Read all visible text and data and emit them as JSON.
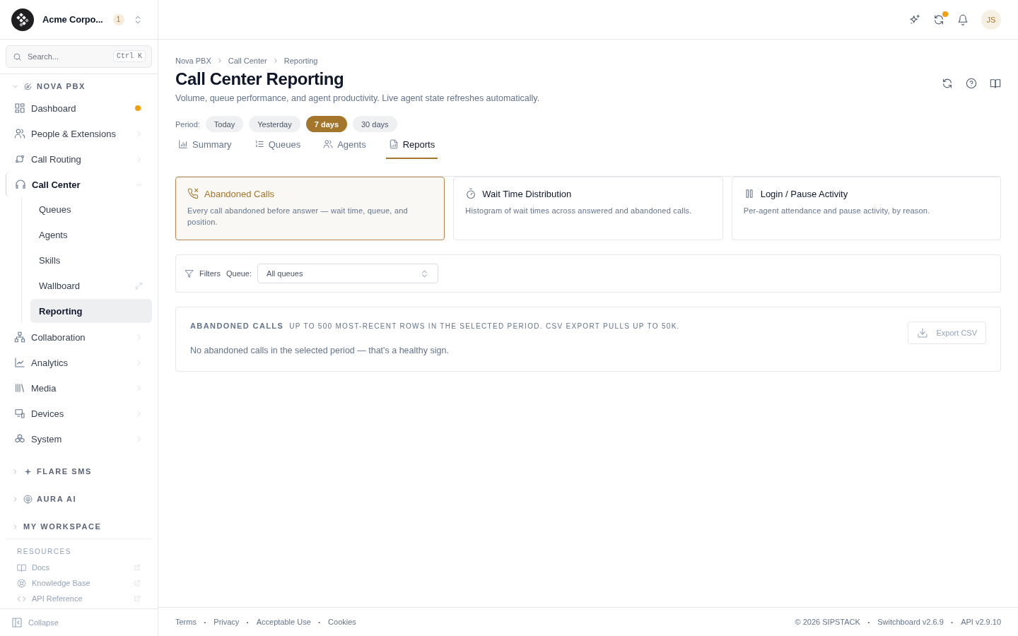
{
  "org": {
    "name": "Acme Corpo...",
    "badge": "1"
  },
  "search": {
    "placeholder": "Search...",
    "shortcut": "Ctrl K"
  },
  "nav_sections": [
    {
      "label": "NOVA PBX",
      "expanded": true,
      "items": [
        {
          "label": "Dashboard",
          "kind": "link",
          "alert": true,
          "selected": false
        },
        {
          "label": "People & Extensions",
          "kind": "group",
          "expanded": false,
          "selected": false
        },
        {
          "label": "Call Routing",
          "kind": "group",
          "expanded": false,
          "selected": false
        },
        {
          "label": "Call Center",
          "kind": "group",
          "expanded": true,
          "selected": true,
          "children": [
            {
              "label": "Queues",
              "selected": false,
              "external": false
            },
            {
              "label": "Agents",
              "selected": false,
              "external": false
            },
            {
              "label": "Skills",
              "selected": false,
              "external": false
            },
            {
              "label": "Wallboard",
              "selected": false,
              "external": true
            },
            {
              "label": "Reporting",
              "selected": true,
              "external": false
            }
          ]
        },
        {
          "label": "Collaboration",
          "kind": "group",
          "expanded": false,
          "selected": false
        },
        {
          "label": "Analytics",
          "kind": "group",
          "expanded": false,
          "selected": false
        },
        {
          "label": "Media",
          "kind": "group",
          "expanded": false,
          "selected": false
        },
        {
          "label": "Devices",
          "kind": "group",
          "expanded": false,
          "selected": false
        },
        {
          "label": "System",
          "kind": "group",
          "expanded": false,
          "selected": false
        }
      ]
    },
    {
      "label": "FLARE SMS",
      "expanded": false
    },
    {
      "label": "AURA AI",
      "expanded": false
    },
    {
      "label": "MY WORKSPACE",
      "expanded": false
    }
  ],
  "resources": {
    "title": "RESOURCES",
    "items": [
      {
        "label": "Docs"
      },
      {
        "label": "Knowledge Base"
      },
      {
        "label": "API Reference"
      }
    ]
  },
  "collapse": "Collapse",
  "topbar": {
    "avatar": "JS",
    "sync_alert": true
  },
  "breadcrumb": [
    "Nova PBX",
    "Call Center",
    "Reporting"
  ],
  "title": "Call Center Reporting",
  "subtitle": "Volume, queue performance, and agent productivity. Live agent state refreshes automatically.",
  "period": {
    "label": "Period:",
    "options": [
      {
        "label": "Today",
        "selected": false
      },
      {
        "label": "Yesterday",
        "selected": false
      },
      {
        "label": "7 days",
        "selected": true
      },
      {
        "label": "30 days",
        "selected": false
      }
    ]
  },
  "tabs": [
    {
      "label": "Summary",
      "selected": false
    },
    {
      "label": "Queues",
      "selected": false
    },
    {
      "label": "Agents",
      "selected": false
    },
    {
      "label": "Reports",
      "selected": true
    }
  ],
  "report_cards": [
    {
      "title": "Abandoned Calls",
      "description": "Every call abandoned before answer — wait time, queue, and position.",
      "selected": true
    },
    {
      "title": "Wait Time Distribution",
      "description": "Histogram of wait times across answered and abandoned calls.",
      "selected": false
    },
    {
      "title": "Login / Pause Activity",
      "description": "Per-agent attendance and pause activity, by reason.",
      "selected": false
    }
  ],
  "filters": {
    "label": "Filters",
    "queue_label": "Queue:",
    "queue_value": "All queues"
  },
  "results": {
    "title": "ABANDONED CALLS",
    "note": "UP TO 500 MOST-RECENT ROWS IN THE SELECTED PERIOD. CSV EXPORT PULLS UP TO 50K.",
    "export": "Export CSV",
    "empty": "No abandoned calls in the selected period — that's a healthy sign."
  },
  "footer": {
    "separator": "·",
    "links": [
      "Terms",
      "Privacy",
      "Acceptable Use",
      "Cookies"
    ],
    "info": [
      "© 2026 SIPSTACK",
      "Switchboard v2.6.9",
      "API v2.9.10"
    ]
  }
}
